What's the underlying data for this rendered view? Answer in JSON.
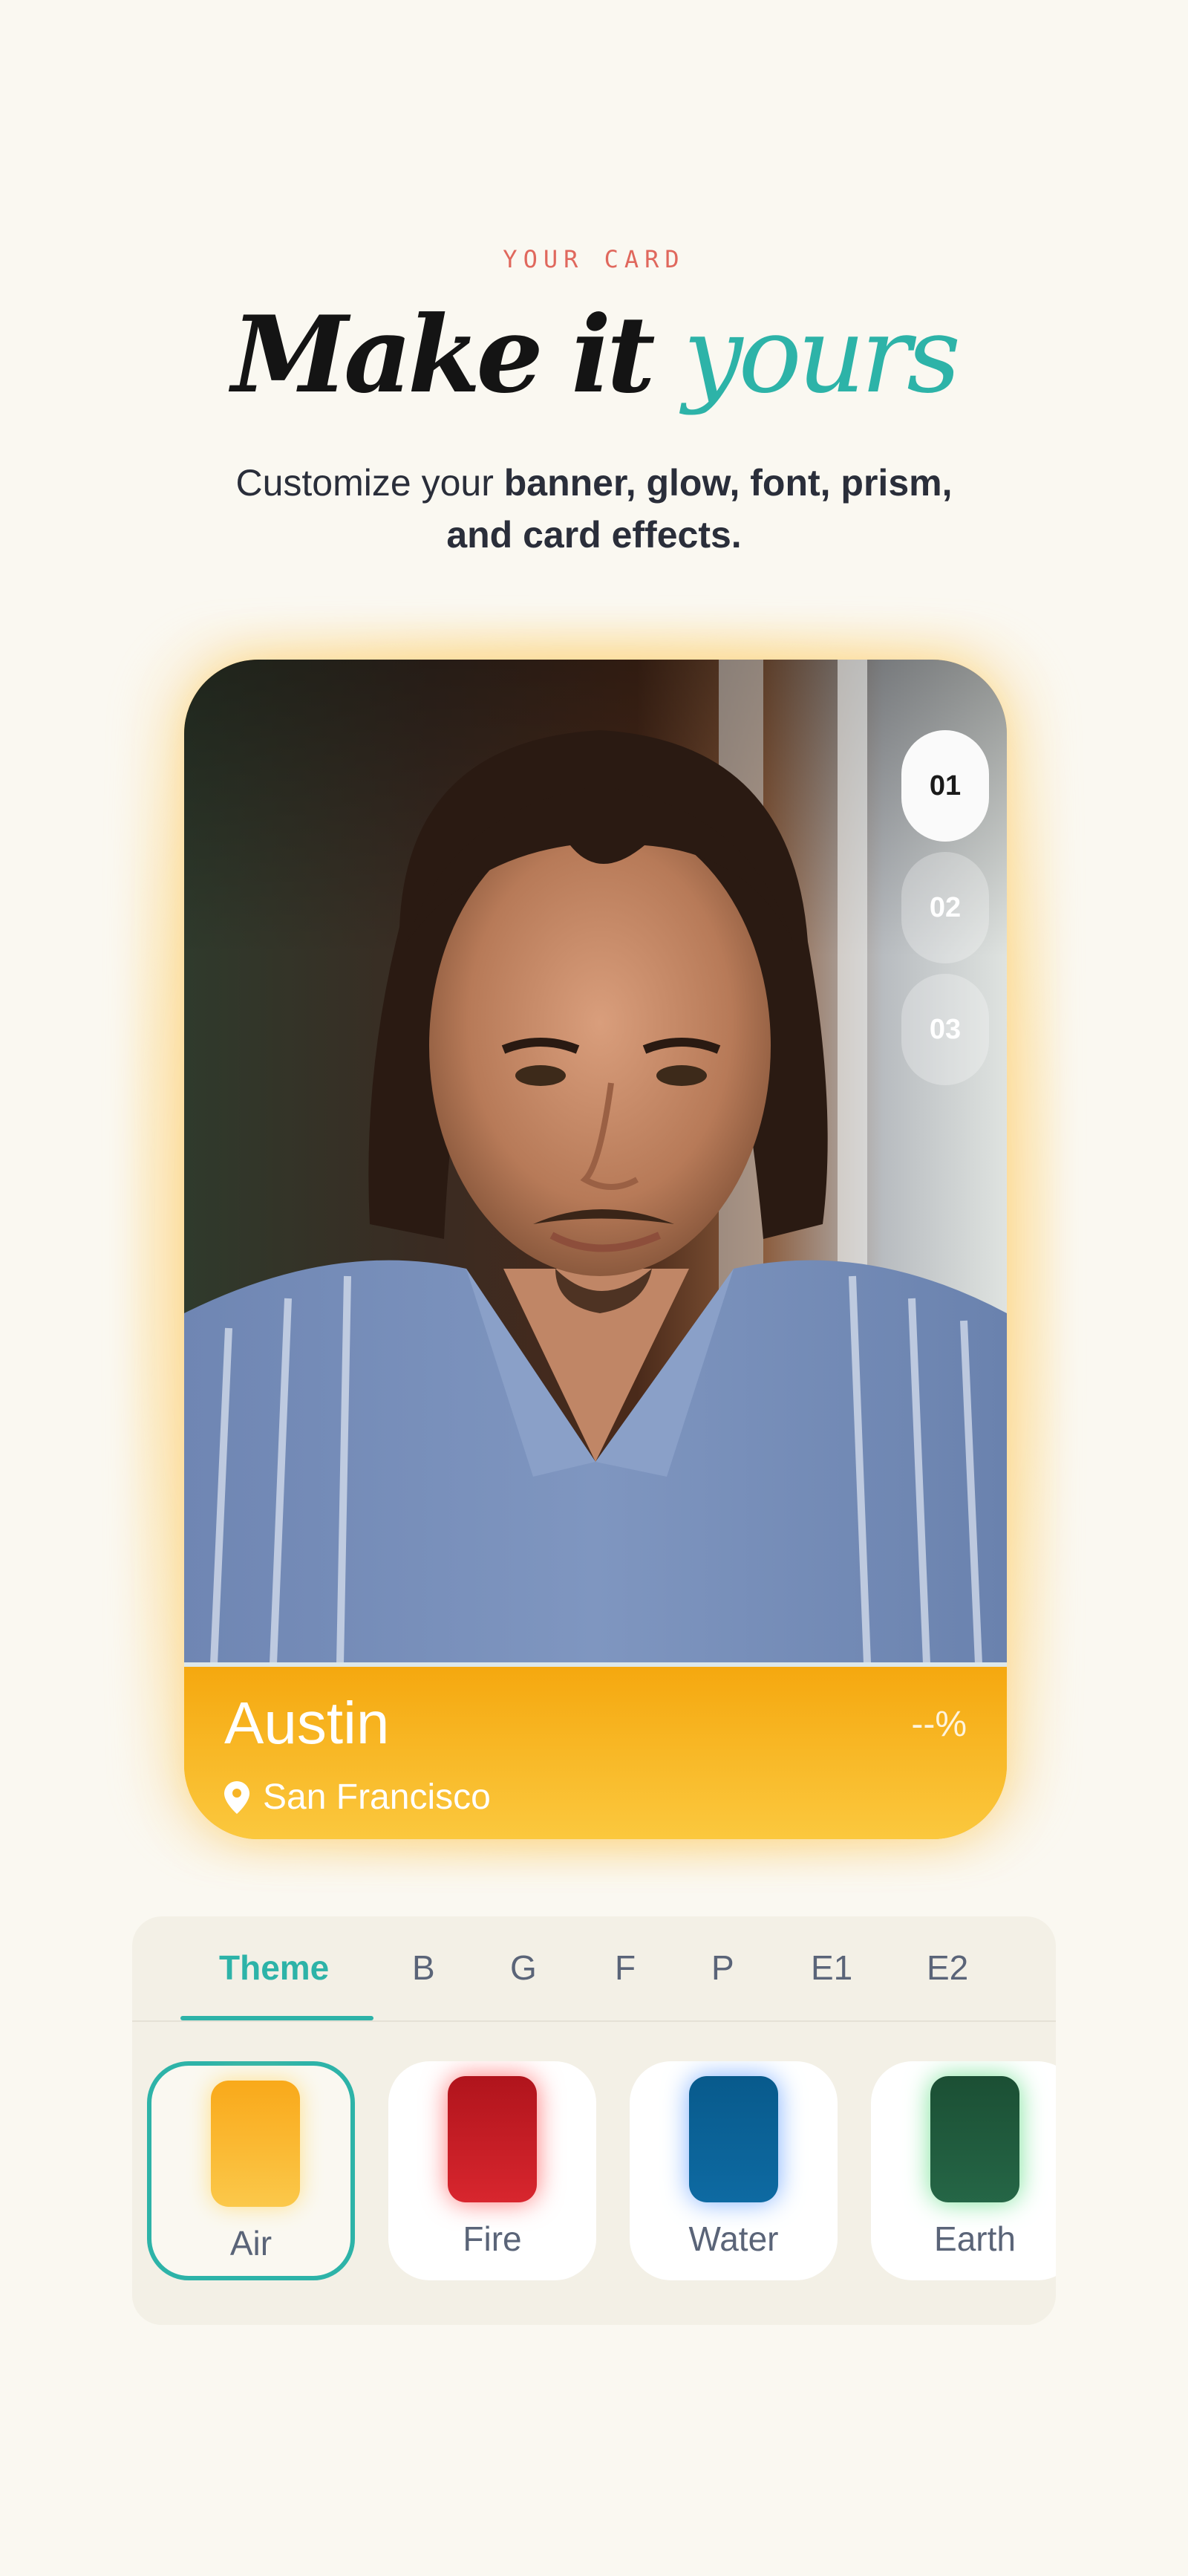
{
  "header": {
    "eyebrow": "YOUR CARD",
    "headline_main": "Make it",
    "headline_accent": "yours",
    "subtitle_lead": "Customize your",
    "subtitle_bold": "banner, glow, font, prism, and card effects."
  },
  "card": {
    "name": "Austin",
    "match_percent": "--%",
    "location": "San Francisco",
    "photo_pages": [
      "01",
      "02",
      "03"
    ],
    "active_page": "01",
    "theme_color": "#f7b425"
  },
  "customizer": {
    "tabs": [
      "Theme",
      "B",
      "G",
      "F",
      "P",
      "E1",
      "E2"
    ],
    "active_tab": "Theme",
    "themes": [
      {
        "label": "Air",
        "color": "#f8b51e",
        "glow": "#ffe08a",
        "selected": true
      },
      {
        "label": "Fire",
        "color": "#c81e24",
        "glow": "#ff7a7a",
        "selected": false
      },
      {
        "label": "Water",
        "color": "#0c5e92",
        "glow": "#7fb0ff",
        "selected": false
      },
      {
        "label": "Earth",
        "color": "#1f5b3c",
        "glow": "#7be39a",
        "selected": false
      }
    ]
  },
  "colors": {
    "accent": "#2db3a8",
    "eyebrow": "#e0685d",
    "background": "#faf8f1"
  }
}
